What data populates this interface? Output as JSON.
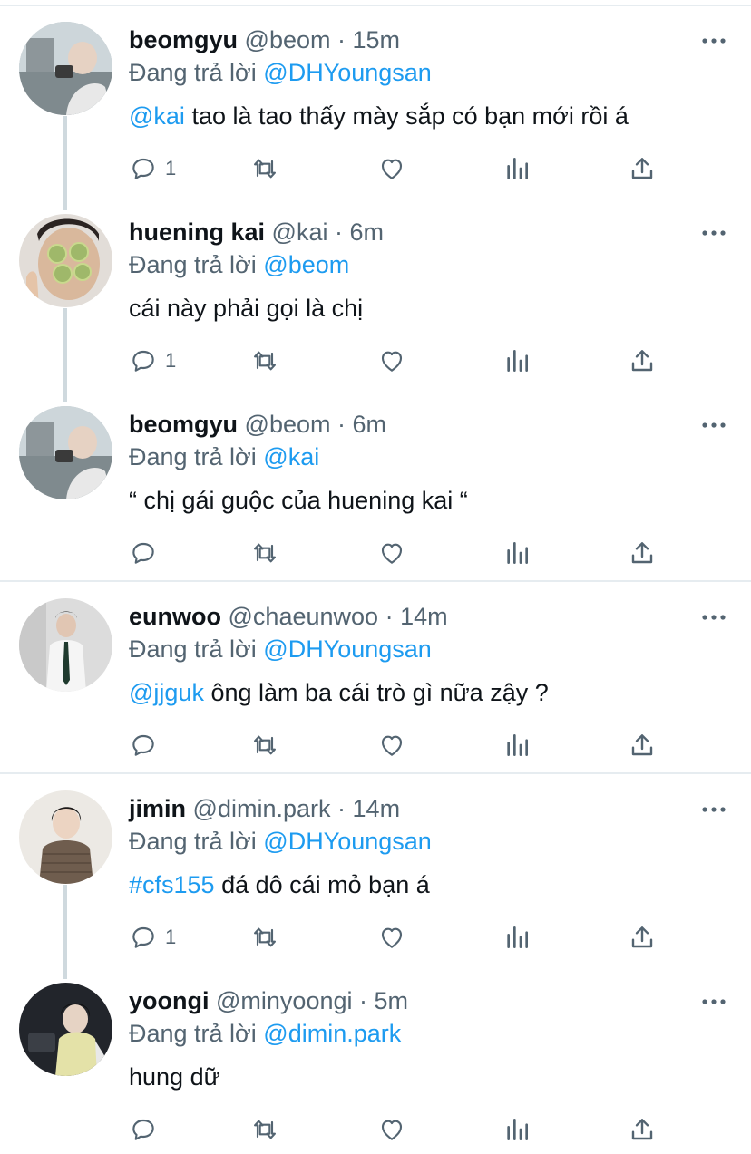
{
  "colors": {
    "link": "#1d9bf0",
    "secondary": "#536471",
    "primary": "#0f1419"
  },
  "tweets": [
    {
      "name": "beomgyu",
      "handle": "@beom",
      "dot": "·",
      "time": "15m",
      "reply_prefix": "Đang trả lời",
      "reply_to": "@DHYoungsan",
      "mention": "@kai",
      "text": " tao là tao thấy mày sắp có bạn mới rồi á",
      "reply_count": "1"
    },
    {
      "name": "huening kai",
      "handle": "@kai",
      "dot": "·",
      "time": "6m",
      "reply_prefix": "Đang trả lời",
      "reply_to": "@beom",
      "mention": "",
      "text": "cái này phải gọi là chị",
      "reply_count": "1"
    },
    {
      "name": "beomgyu",
      "handle": "@beom",
      "dot": "·",
      "time": "6m",
      "reply_prefix": "Đang trả lời",
      "reply_to": "@kai",
      "mention": "",
      "text": "“ chị gái guộc của huening kai “",
      "reply_count": ""
    },
    {
      "name": "eunwoo",
      "handle": "@chaeunwoo",
      "dot": "·",
      "time": "14m",
      "reply_prefix": "Đang trả lời",
      "reply_to": "@DHYoungsan",
      "mention": "@jjguk",
      "text": " ông làm ba cái trò gì nữa zậy ?",
      "reply_count": ""
    },
    {
      "name": "jimin",
      "handle": "@dimin.park",
      "dot": "·",
      "time": "14m",
      "reply_prefix": "Đang trả lời",
      "reply_to": "@DHYoungsan",
      "mention": "#cfs155",
      "text": " đá dô cái mỏ bạn á",
      "reply_count": "1"
    },
    {
      "name": "yoongi",
      "handle": "@minyoongi",
      "dot": "·",
      "time": "5m",
      "reply_prefix": "Đang trả lời",
      "reply_to": "@dimin.park",
      "mention": "",
      "text": "hung dữ",
      "reply_count": ""
    }
  ],
  "icons": [
    "reply-icon",
    "retweet-icon",
    "like-icon",
    "analytics-icon",
    "share-icon",
    "more-icon"
  ]
}
